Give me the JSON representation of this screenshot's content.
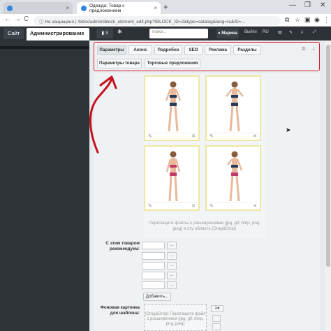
{
  "browser": {
    "tab1_title": "",
    "tab2_title": "Одежда: Товар с предложением",
    "new_tab": "+",
    "back": "←",
    "forward": "→",
    "reload": "C",
    "url_security": "Не защищено",
    "url": "/bitrix/admin/iblock_element_edit.php?IBLOCK_ID=2&type=catalog&lang=ru&ID=..."
  },
  "adminbar": {
    "site": "Сайт",
    "admin": "Администрирование",
    "notifications": "3",
    "search_placeholder": "поиск...",
    "user": "Марина",
    "logout": "Выйти",
    "lang": "RU"
  },
  "tabs": {
    "main": [
      {
        "label": "Параметры"
      },
      {
        "label": "Анонс"
      },
      {
        "label": "Подробно"
      },
      {
        "label": "SEO"
      },
      {
        "label": "Реклама"
      },
      {
        "label": "Разделы"
      }
    ],
    "sub": [
      {
        "label": "Параметры товара"
      },
      {
        "label": "Торговые предложения"
      }
    ]
  },
  "gallery": {
    "drop_hint": "Перетащите файлы с расширениями (jpg, gif, bmp, png, jpeg) в эту область (Drag&Drop)",
    "edit_icon": "pencil-icon",
    "delete_icon": "close-icon"
  },
  "recommend": {
    "label": "С этим товаром рекомендуем:",
    "pick_button": "...",
    "add_button": "Добавить..."
  },
  "background": {
    "label": "Фоновая картинка для шаблона:",
    "drop_hint": "(Drag&Drop) Перетащите файл с расширением (jpg, gif, bmp, png, jpeg)"
  },
  "colors": {
    "highlight": "#d8202a",
    "admin_bar": "#2d3237",
    "image_border": "#efe6a3"
  }
}
